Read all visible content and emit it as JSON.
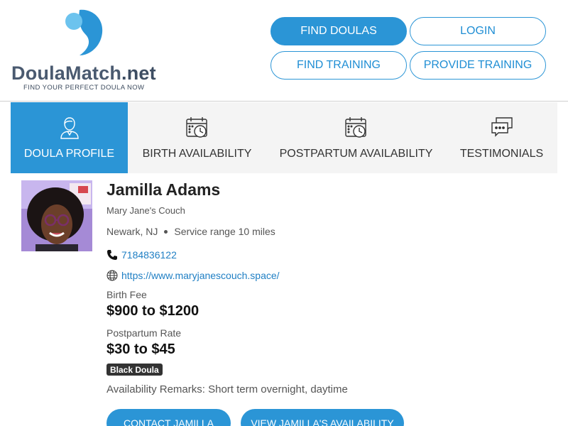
{
  "brand": {
    "name_main": "DoulaMatch",
    "name_tld": ".net",
    "tagline": "FIND YOUR PERFECT DOULA NOW",
    "colors": {
      "primary": "#2b95d6",
      "logo_light": "#6cc3ee",
      "text_dark": "#4a5a70"
    }
  },
  "nav": {
    "find_doulas": "FIND DOULAS",
    "login": "LOGIN",
    "find_training": "FIND TRAINING",
    "provide_training": "PROVIDE TRAINING"
  },
  "tabs": [
    {
      "label": "DOULA PROFILE",
      "icon": "person-icon",
      "active": true
    },
    {
      "label": "BIRTH AVAILABILITY",
      "icon": "calendar-clock-icon",
      "active": false
    },
    {
      "label": "POSTPARTUM AVAILABILITY",
      "icon": "calendar-clock-icon",
      "active": false
    },
    {
      "label": "TESTIMONIALS",
      "icon": "chat-bubbles-icon",
      "active": false
    }
  ],
  "profile": {
    "name": "Jamilla Adams",
    "business": "Mary Jane's Couch",
    "location": "Newark, NJ",
    "service_range": "Service range 10 miles",
    "phone": "7184836122",
    "website": "https://www.maryjanescouch.space/",
    "birth_fee_label": "Birth Fee",
    "birth_fee": "$900 to $1200",
    "postpartum_label": "Postpartum Rate",
    "postpartum_rate": "$30 to $45",
    "badge": "Black Doula",
    "remarks": "Availability Remarks: Short term overnight, daytime"
  },
  "actions": {
    "contact": "CONTACT JAMILLA",
    "availability": "VIEW JAMILLA'S AVAILABILITY"
  }
}
